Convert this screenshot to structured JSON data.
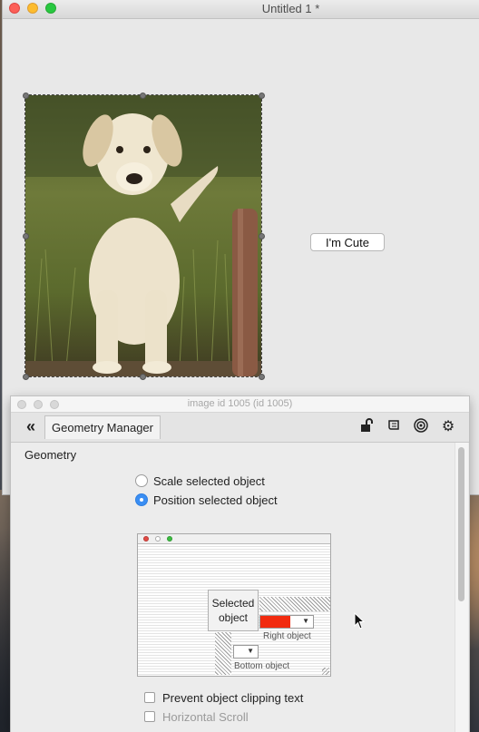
{
  "main_window": {
    "title": "Untitled 1 *"
  },
  "canvas": {
    "button_label": "I'm Cute"
  },
  "palette": {
    "title": "image id 1005 (id 1005)",
    "tab_label": "Geometry Manager",
    "toolbar_icons": [
      "lock-icon",
      "script-icon",
      "target-icon",
      "gear-icon"
    ],
    "section_label": "Geometry",
    "radio_options": [
      {
        "label": "Scale selected object",
        "selected": false
      },
      {
        "label": "Position selected object",
        "selected": true
      }
    ],
    "diagram": {
      "selected_label_line1": "Selected",
      "selected_label_line2": "object",
      "right_label": "Right object",
      "bottom_label": "Bottom object"
    },
    "checkboxes": [
      {
        "label": "Prevent object clipping text",
        "checked": false
      },
      {
        "label": "Horizontal Scroll",
        "checked": false
      }
    ]
  },
  "colors": {
    "accent": "#3a8ef3",
    "right_object_fill": "#f22b0f"
  }
}
